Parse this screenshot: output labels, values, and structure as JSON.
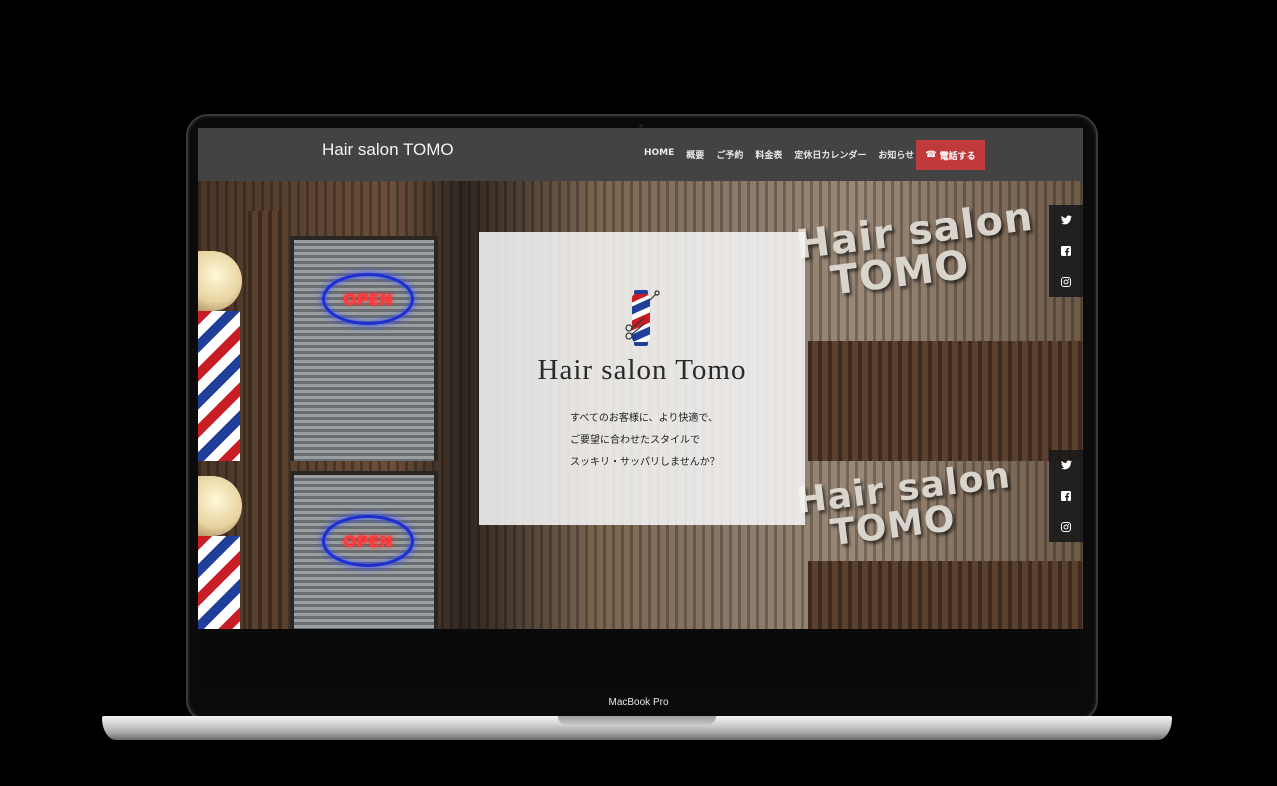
{
  "site": {
    "title": "Hair salon TOMO"
  },
  "nav": {
    "items": [
      "HOME",
      "概要",
      "ご予約",
      "料金表",
      "定休日カレンダー",
      "お知らせ"
    ],
    "phone_button": "電話する",
    "phone_icon": "phone-icon"
  },
  "hero": {
    "title": "Hair salon Tomo",
    "lines": [
      "すべてのお客様に、より快適で、",
      "ご要望に合わせたスタイルで",
      "スッキリ・サッパリしませんか？"
    ],
    "photo_sign_open": "OPEN",
    "photo_wall_sign_line1": "Hair salon",
    "photo_wall_sign_line2": "TOMO"
  },
  "social": {
    "icons": [
      "twitter-icon",
      "facebook-icon",
      "instagram-icon"
    ]
  },
  "device": {
    "label": "MacBook Pro"
  },
  "colors": {
    "accent": "#c0393b",
    "header_bg": "#464646",
    "card_bg": "#f6f6f6"
  }
}
